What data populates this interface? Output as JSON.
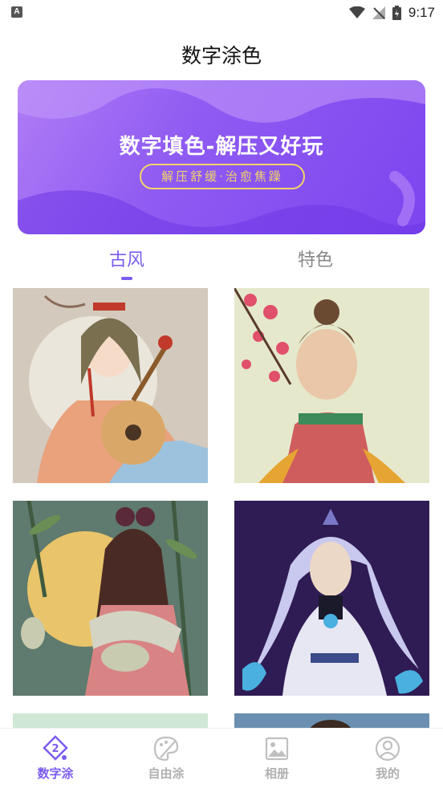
{
  "status_bar": {
    "time": "9:17",
    "left_icon": "A"
  },
  "header": {
    "title": "数字涂色"
  },
  "banner": {
    "headline": "数字填色-解压又好玩",
    "tagline": "解压舒缓·治愈焦躁"
  },
  "tabs": [
    {
      "label": "古风",
      "active": true
    },
    {
      "label": "特色",
      "active": false
    }
  ],
  "gallery": [
    {
      "alt": "illustration-pipa-girl"
    },
    {
      "alt": "illustration-blossom-girl"
    },
    {
      "alt": "illustration-bamboo-rabbit"
    },
    {
      "alt": "illustration-silver-hair-man"
    },
    {
      "alt": "illustration-partial-5"
    },
    {
      "alt": "illustration-partial-6"
    }
  ],
  "bottom_nav": [
    {
      "label": "数字涂",
      "icon": "number-paint-icon",
      "active": true,
      "badge": "2"
    },
    {
      "label": "自由涂",
      "icon": "palette-icon",
      "active": false
    },
    {
      "label": "相册",
      "icon": "album-icon",
      "active": false
    },
    {
      "label": "我的",
      "icon": "profile-icon",
      "active": false
    }
  ],
  "colors": {
    "accent": "#7b5cf0",
    "inactive": "#b0b0b0",
    "banner_gold": "#f3d36a"
  }
}
